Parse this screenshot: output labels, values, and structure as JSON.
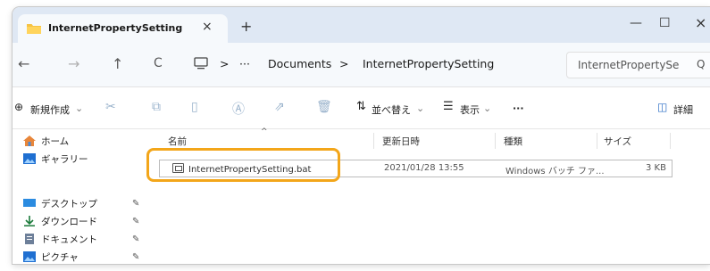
{
  "tab": {
    "title": "InternetPropertySetting",
    "close": "×"
  },
  "titlebar": {
    "new_tab": "+",
    "minimize": "—",
    "maximize": "☐",
    "close": "×"
  },
  "nav": {
    "back": "←",
    "forward": "→",
    "up": "↑",
    "refresh": "C"
  },
  "breadcrumb": [
    "Documents",
    "InternetPropertySetting"
  ],
  "breadcrumb_separators": [
    ">",
    "···",
    ">",
    ">"
  ],
  "search": {
    "placeholder": "InternetPropertySe",
    "icon": "Q"
  },
  "toolbar": {
    "new_label": "新規作成",
    "sort_label": "並べ替え",
    "view_label": "表示",
    "more": "···",
    "details_label": "詳細",
    "plus": "⊕",
    "chev": "⌄"
  },
  "sidebar": {
    "items": [
      {
        "label": "ホーム",
        "icon": "home-icon"
      },
      {
        "label": "ギャラリー",
        "icon": "gallery-icon"
      },
      {
        "label": "デスクトップ",
        "icon": "desktop-icon",
        "pinned": true
      },
      {
        "label": "ダウンロード",
        "icon": "download-icon",
        "pinned": true
      },
      {
        "label": "ドキュメント",
        "icon": "documents-icon",
        "pinned": true
      },
      {
        "label": "ピクチャ",
        "icon": "pictures-icon",
        "pinned": true
      }
    ],
    "pin_glyph": "📌"
  },
  "columns": [
    "名前",
    "更新日時",
    "種類",
    "サイズ"
  ],
  "files": [
    {
      "name": "InternetPropertySetting.bat",
      "modified": "2021/01/28 13:55",
      "type": "Windows バッチ ファ...",
      "size": "3 KB"
    }
  ],
  "colors": {
    "accent": "#f3a61a",
    "titlebar": "#dfe8f4"
  }
}
